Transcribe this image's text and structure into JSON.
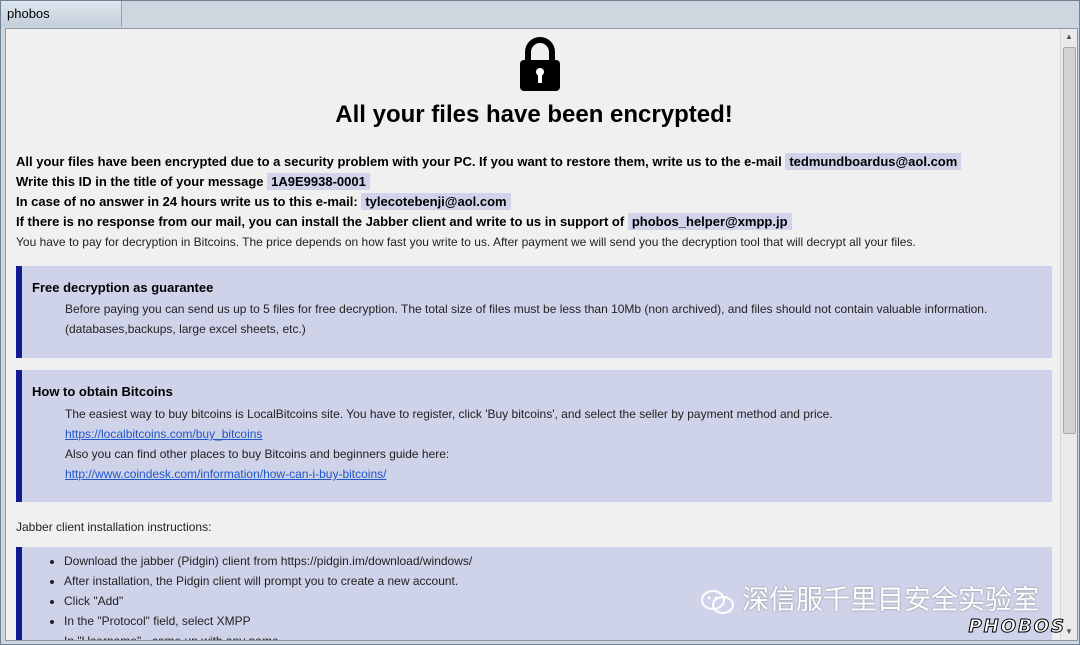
{
  "window": {
    "title": "phobos"
  },
  "heading": "All your files have been encrypted!",
  "info": {
    "line1_text": "All your files have been encrypted due to a security problem with your PC. If you want to restore them, write us to the e-mail",
    "line1_email": "tedmundboardus@aol.com",
    "line2_text": "Write this ID in the title of your message",
    "line2_id": "1A9E9938-0001",
    "line3_text": "In case of no answer in 24 hours write us to this e-mail:",
    "line3_email": "tylecotebenji@aol.com",
    "line4_text": "If there is no response from our mail, you can install the Jabber client and write to us in support of",
    "line4_jabber": "phobos_helper@xmpp.jp",
    "line5_text": "You have to pay for decryption in Bitcoins. The price depends on how fast you write to us. After payment we will send you the decryption tool that will decrypt all your files."
  },
  "free_decryption": {
    "title": "Free decryption as guarantee",
    "line1": "Before paying you can send us up to 5 files for free decryption. The total size of files must be less than 10Mb (non archived), and files should not contain valuable information.",
    "line2": "(databases,backups, large excel sheets, etc.)"
  },
  "bitcoins": {
    "title": "How to obtain Bitcoins",
    "line1": "The easiest way to buy bitcoins is LocalBitcoins site. You have to register, click 'Buy bitcoins', and select the seller by payment method and price.",
    "link1": "https://localbitcoins.com/buy_bitcoins",
    "line2": "Also you can find other places to buy Bitcoins and beginners guide here:",
    "link2": "http://www.coindesk.com/information/how-can-i-buy-bitcoins/"
  },
  "jabber": {
    "label": "Jabber client installation instructions:",
    "steps": [
      "Download the jabber (Pidgin) client from https://pidgin.im/download/windows/",
      "After installation, the Pidgin client will prompt you to create a new account.",
      "Click \"Add\"",
      "In the \"Protocol\" field, select XMPP",
      "In \"Username\" - come up with any name"
    ]
  },
  "watermark": "深信服千里目安全实验室",
  "brand": "PHOBOS",
  "colors": {
    "box_bg": "#cfd3ea",
    "box_border": "#101a8c",
    "link": "#2056c8",
    "email_highlight": "#d0d3ea"
  },
  "icons": [
    "lock-icon",
    "wechat-icon"
  ]
}
